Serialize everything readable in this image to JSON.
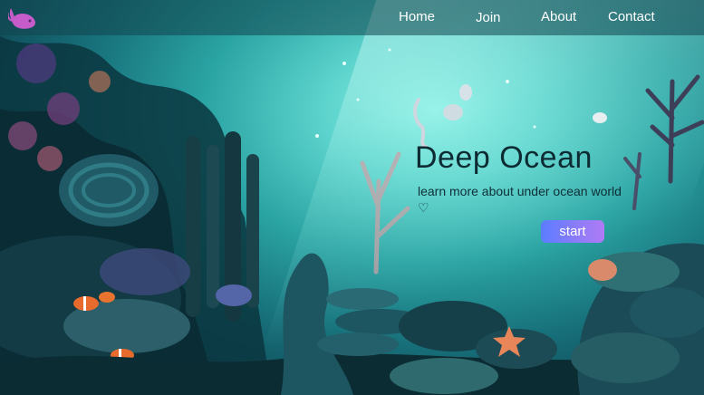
{
  "nav": {
    "home": "Home",
    "join": "Join",
    "about": "About",
    "contact": "Contact"
  },
  "hero": {
    "title": "Deep Ocean",
    "subtitle_text": "learn more about under ocean world",
    "heart": "♡",
    "cta": "start"
  },
  "colors": {
    "accent_gradient_start": "#5b7dff",
    "accent_gradient_end": "#b07bf5",
    "logo": "#c65cc9",
    "navbar": "#12464e"
  },
  "icons": {
    "logo": "whale-icon",
    "subtitle": "heart-icon"
  }
}
